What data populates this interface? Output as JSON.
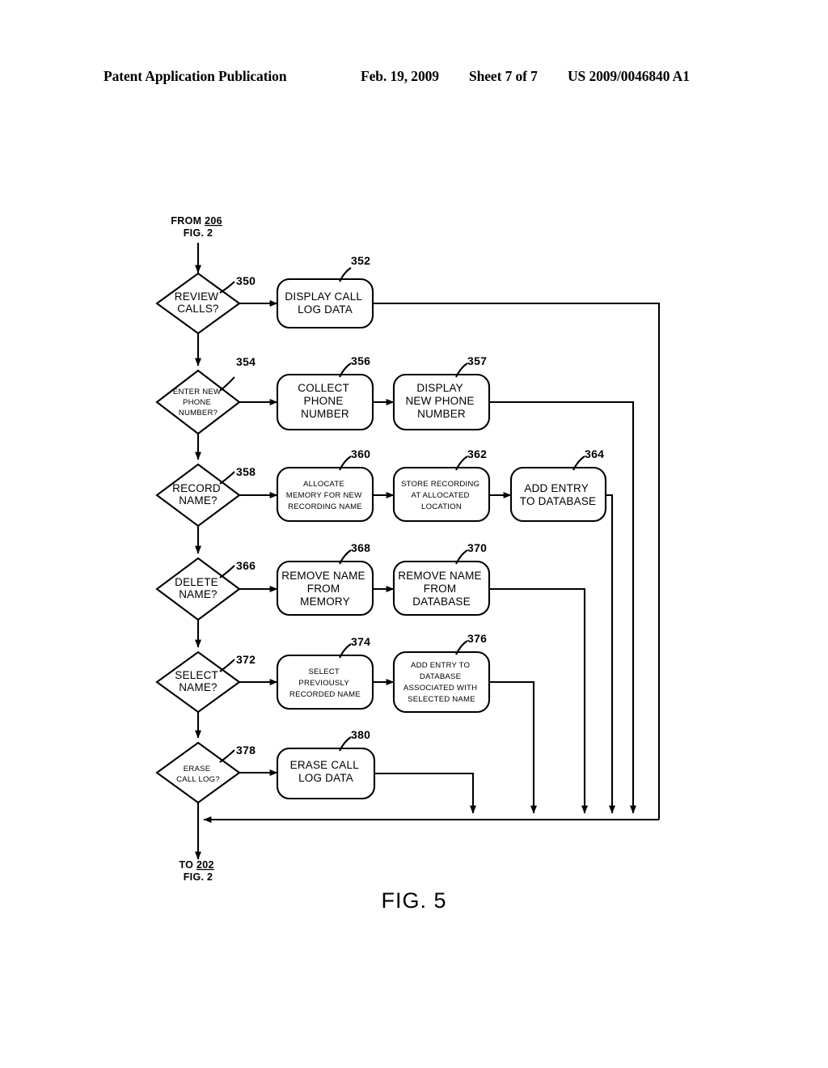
{
  "header": {
    "publication": "Patent Application Publication",
    "date": "Feb. 19, 2009",
    "sheet": "Sheet 7 of 7",
    "patent_number": "US 2009/0046840 A1"
  },
  "figure": {
    "caption": "FIG. 5",
    "entry_connector": {
      "line1_prefix": "FROM ",
      "line1_ref": "206",
      "line2": "FIG. 2"
    },
    "exit_connector": {
      "line1_prefix": "TO ",
      "line1_ref": "202",
      "line2": "FIG. 2"
    },
    "decisions": [
      {
        "ref": "350",
        "lines": [
          "REVIEW",
          "CALLS?"
        ],
        "size": "lg"
      },
      {
        "ref": "354",
        "lines": [
          "ENTER NEW",
          "PHONE",
          "NUMBER?"
        ],
        "size": "sm"
      },
      {
        "ref": "358",
        "lines": [
          "RECORD",
          "NAME?"
        ],
        "size": "lg"
      },
      {
        "ref": "366",
        "lines": [
          "DELETE",
          "NAME?"
        ],
        "size": "lg"
      },
      {
        "ref": "372",
        "lines": [
          "SELECT",
          "NAME?"
        ],
        "size": "lg"
      },
      {
        "ref": "378",
        "lines": [
          "ERASE",
          "CALL LOG?"
        ],
        "size": "sm"
      }
    ],
    "processes": [
      {
        "ref": "352",
        "lines": [
          "DISPLAY CALL",
          "LOG DATA"
        ],
        "size": "lg"
      },
      {
        "ref": "356",
        "lines": [
          "COLLECT",
          "PHONE",
          "NUMBER"
        ],
        "size": "lg"
      },
      {
        "ref": "357",
        "lines": [
          "DISPLAY",
          "NEW PHONE",
          "NUMBER"
        ],
        "size": "lg"
      },
      {
        "ref": "360",
        "lines": [
          "ALLOCATE",
          "MEMORY FOR NEW",
          "RECORDING NAME"
        ],
        "size": "sm"
      },
      {
        "ref": "362",
        "lines": [
          "STORE RECORDING",
          "AT ALLOCATED",
          "LOCATION"
        ],
        "size": "sm"
      },
      {
        "ref": "364",
        "lines": [
          "ADD ENTRY",
          "TO DATABASE"
        ],
        "size": "lg"
      },
      {
        "ref": "368",
        "lines": [
          "REMOVE NAME",
          "FROM",
          "MEMORY"
        ],
        "size": "lg"
      },
      {
        "ref": "370",
        "lines": [
          "REMOVE NAME",
          "FROM",
          "DATABASE"
        ],
        "size": "lg"
      },
      {
        "ref": "374",
        "lines": [
          "SELECT",
          "PREVIOUSLY",
          "RECORDED NAME"
        ],
        "size": "sm"
      },
      {
        "ref": "376",
        "lines": [
          "ADD ENTRY TO",
          "DATABASE",
          "ASSOCIATED WITH",
          "SELECTED NAME"
        ],
        "size": "sm"
      },
      {
        "ref": "380",
        "lines": [
          "ERASE CALL",
          "LOG DATA"
        ],
        "size": "lg"
      }
    ]
  }
}
